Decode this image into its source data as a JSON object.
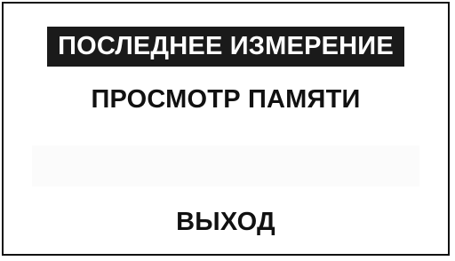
{
  "menu": {
    "items": [
      {
        "label": "ПОСЛЕДНЕЕ ИЗМЕРЕНИЕ",
        "selected": true
      },
      {
        "label": "ПРОСМОТР ПАМЯТИ",
        "selected": false
      },
      {
        "label": "",
        "selected": false
      },
      {
        "label": "ВЫХОД",
        "selected": false
      }
    ]
  },
  "colors": {
    "highlight_background": "#1a1a1a",
    "highlight_text": "#ffffff",
    "text": "#111111",
    "border": "#111111",
    "background": "#ffffff"
  }
}
